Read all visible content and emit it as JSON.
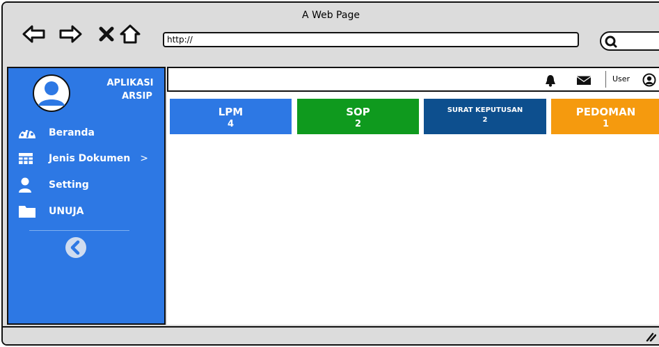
{
  "window": {
    "title": "A Web Page"
  },
  "browser": {
    "url": "http://"
  },
  "sidebar": {
    "app_title_line1": "APLIKASI",
    "app_title_line2": "ARSIP",
    "items": [
      {
        "label": "Beranda",
        "icon": "dashboard-icon"
      },
      {
        "label": "Jenis Dokumen",
        "icon": "table-icon",
        "chevron": ">"
      },
      {
        "label": "Setting",
        "icon": "user-icon"
      },
      {
        "label": "UNUJA",
        "icon": "folder-icon"
      }
    ]
  },
  "topbar": {
    "user_label": "User"
  },
  "cards": [
    {
      "name": "LPM",
      "count": "4",
      "color": "#2d78e4"
    },
    {
      "name": "SOP",
      "count": "2",
      "color": "#0f9a1e"
    },
    {
      "name": "SURAT KEPUTUSAN",
      "count": "2",
      "color": "#0d4f8e"
    },
    {
      "name": "PEDOMAN",
      "count": "1",
      "color": "#f59a0e"
    }
  ],
  "colors": {
    "sidebar": "#2d78e4",
    "chrome": "#dcdcdc"
  }
}
